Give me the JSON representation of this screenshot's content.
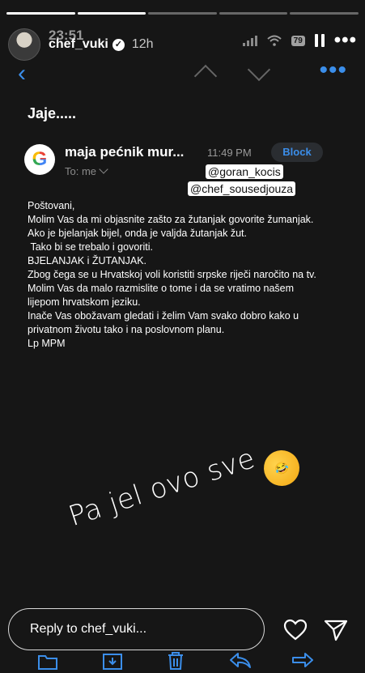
{
  "story": {
    "username": "chef_vuki",
    "time_ago": "12h",
    "status_time": "23:51",
    "battery": "79",
    "progress": [
      1,
      1,
      0,
      0,
      0
    ]
  },
  "email": {
    "subject": "Jaje.....",
    "sender": "maja pećnik mur...",
    "time": "11:49 PM",
    "block_label": "Block",
    "to": "To: me",
    "body": [
      "Poštovani,",
      "Molim Vas da mi objasnite zašto za žutanjak govorite žumanjak.",
      "Ako je bjelanjak bijel, onda je valjda žutanjak žut.",
      " Tako bi se trebalo i govoriti.",
      "BJELANJAK i ŽUTANJAK.",
      "Zbog čega se u Hrvatskoj voli koristiti srpske riječi naročito na tv.",
      "Molim Vas da malo razmislite o tome i da se vratimo našem lijepom hrvatskom jeziku.",
      "Inače Vas obožavam gledati i želim Vam svako dobro kako u privatnom životu tako i na poslovnom planu.",
      "Lp MPM"
    ]
  },
  "mentions": [
    "@goran_kocis",
    "@chef_sousedjouza"
  ],
  "overlay_text": "Pa jel ovo sve",
  "reply": {
    "placeholder": "Reply to chef_vuki..."
  },
  "icons": {
    "back": "chevron-left-icon",
    "up": "chevron-up-icon",
    "down": "chevron-down-icon",
    "more": "more-horizontal-icon",
    "heart": "heart-icon",
    "send": "send-icon",
    "emoji": "rofl-emoji"
  },
  "colors": {
    "accent": "#3b8eea",
    "background": "#161616"
  }
}
